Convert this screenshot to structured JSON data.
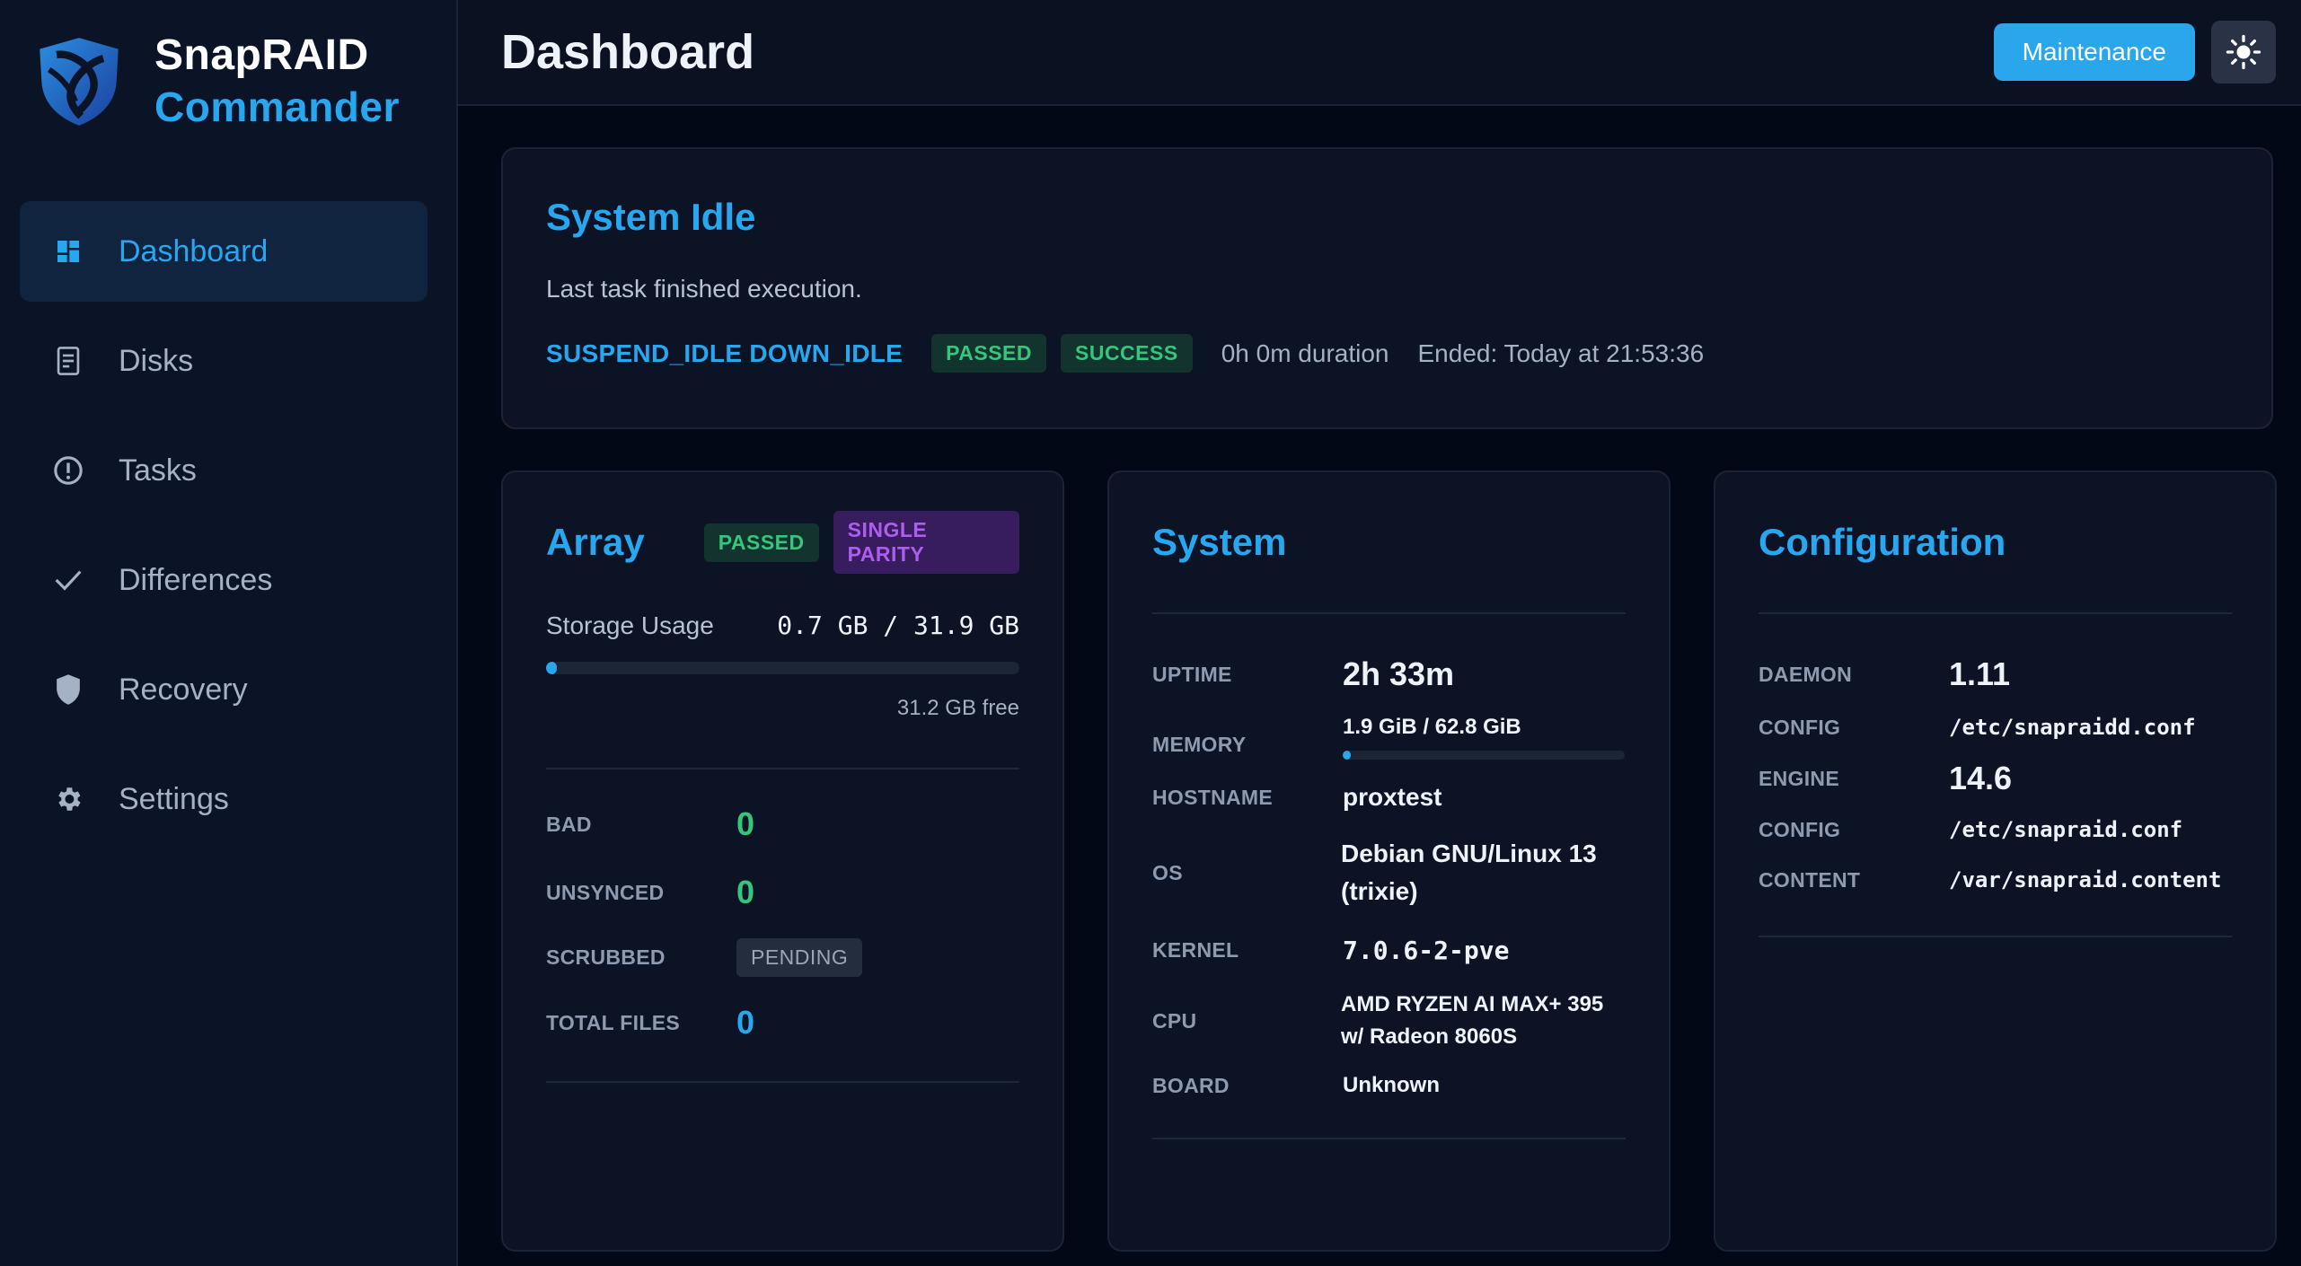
{
  "brand": {
    "name": "SnapRAID",
    "sub": "Commander"
  },
  "nav": [
    {
      "label": "Dashboard",
      "icon": "dashboard-icon",
      "active": true
    },
    {
      "label": "Disks",
      "icon": "disk-icon"
    },
    {
      "label": "Tasks",
      "icon": "alert-circle-icon"
    },
    {
      "label": "Differences",
      "icon": "check-icon"
    },
    {
      "label": "Recovery",
      "icon": "shield-icon"
    },
    {
      "label": "Settings",
      "icon": "gear-icon"
    }
  ],
  "header": {
    "title": "Dashboard",
    "maintenance_label": "Maintenance",
    "theme_icon": "sun-icon"
  },
  "status": {
    "title": "System Idle",
    "message": "Last task finished execution.",
    "task": "SUSPEND_IDLE DOWN_IDLE",
    "badge1": "PASSED",
    "badge2": "SUCCESS",
    "duration": "0h 0m duration",
    "ended": "Ended: Today at 21:53:36"
  },
  "array": {
    "title": "Array",
    "badge_status": "PASSED",
    "badge_parity": "SINGLE PARITY",
    "usage_label": "Storage Usage",
    "usage_value": "0.7 GB / 31.9 GB",
    "usage_fraction": 0.022,
    "free": "31.2 GB free",
    "rows": {
      "bad_label": "BAD",
      "bad_value": "0",
      "unsynced_label": "UNSYNCED",
      "unsynced_value": "0",
      "scrubbed_label": "SCRUBBED",
      "scrubbed_value": "PENDING",
      "files_label": "TOTAL FILES",
      "files_value": "0"
    }
  },
  "system": {
    "title": "System",
    "uptime_label": "UPTIME",
    "uptime": "2h 33m",
    "memory_label": "MEMORY",
    "memory": "1.9 GiB / 62.8 GiB",
    "memory_fraction": 0.03,
    "hostname_label": "HOSTNAME",
    "hostname": "proxtest",
    "os_label": "OS",
    "os": "Debian GNU/Linux 13 (trixie)",
    "kernel_label": "KERNEL",
    "kernel": "7.0.6-2-pve",
    "cpu_label": "CPU",
    "cpu": "AMD RYZEN AI MAX+ 395 w/ Radeon 8060S",
    "board_label": "BOARD",
    "board": "Unknown"
  },
  "config": {
    "title": "Configuration",
    "daemon_label": "DAEMON",
    "daemon": "1.11",
    "config1_label": "CONFIG",
    "config1": "/etc/snapraidd.conf",
    "engine_label": "ENGINE",
    "engine": "14.6",
    "config2_label": "CONFIG",
    "config2": "/etc/snapraid.conf",
    "content_label": "CONTENT",
    "content": "/var/snapraid.content"
  },
  "colors": {
    "accent": "#27a7f0",
    "success": "#34c77b",
    "purple": "#b05cf0",
    "background": "#030816"
  }
}
